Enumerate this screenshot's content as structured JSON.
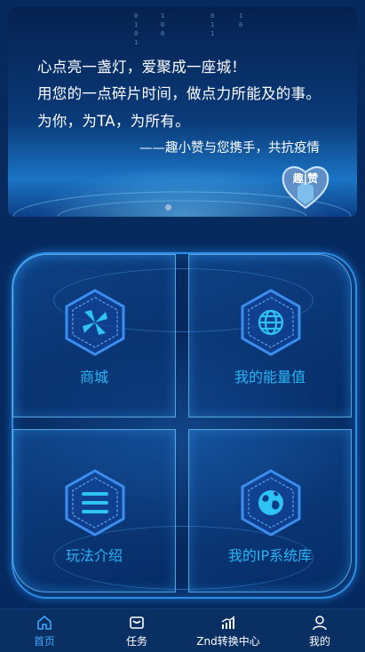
{
  "banner": {
    "line1": "心点亮一盏灯，爱聚成一座城！",
    "line2": "用您的一点碎片时间，做点力所能及的事。",
    "line3": "为你，为TA，为所有。",
    "signature": "——趣小赞与您携手，共抗疫情",
    "badge_text": "趣|赞",
    "carousel_index": 1
  },
  "tiles": [
    {
      "label": "商城",
      "icon": "pinwheel-icon"
    },
    {
      "label": "我的能量值",
      "icon": "globe-icon"
    },
    {
      "label": "玩法介绍",
      "icon": "menu-icon"
    },
    {
      "label": "我的IP系统库",
      "icon": "earth-icon"
    }
  ],
  "nav": {
    "items": [
      {
        "label": "首页",
        "icon": "home-icon",
        "active": true
      },
      {
        "label": "任务",
        "icon": "inbox-icon",
        "active": false
      },
      {
        "label": "Znd转换中心",
        "icon": "chart-icon",
        "active": false
      },
      {
        "label": "我的",
        "icon": "user-icon",
        "active": false
      }
    ]
  },
  "colors": {
    "background": "#062a5e",
    "accent": "#28b4f2",
    "nav_active": "#3fa9ff",
    "frame": "#2e8ee6"
  }
}
